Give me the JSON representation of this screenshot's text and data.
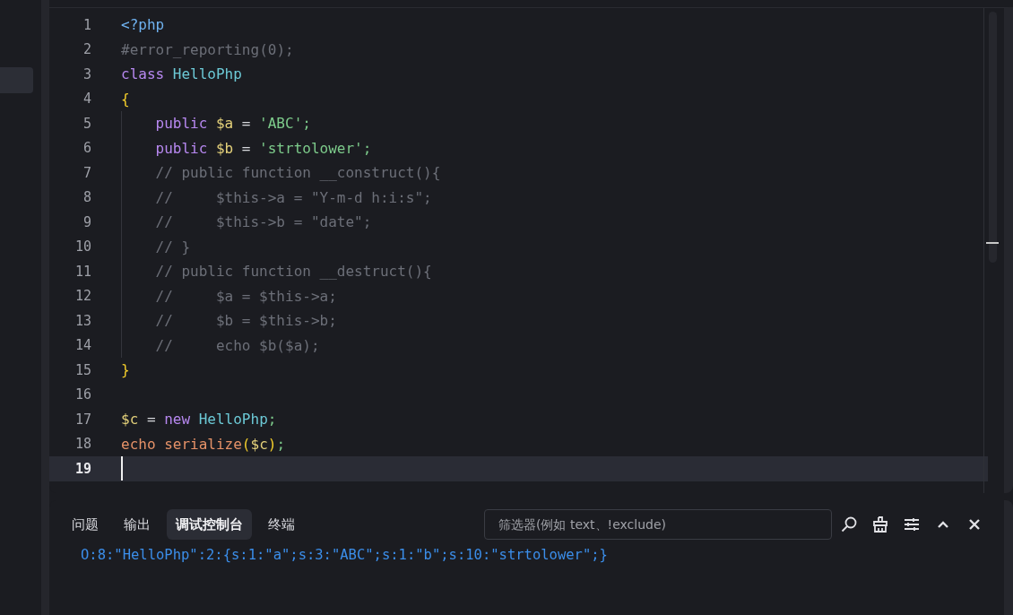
{
  "editor": {
    "lines": [
      {
        "number": "1",
        "indent": false,
        "current": false,
        "tokens": [
          {
            "kind": "tag",
            "text": "<?php"
          }
        ]
      },
      {
        "number": "2",
        "indent": false,
        "current": false,
        "tokens": [
          {
            "kind": "comment",
            "text": "#error_reporting(0);"
          }
        ]
      },
      {
        "number": "3",
        "indent": false,
        "current": false,
        "tokens": [
          {
            "kind": "keyword",
            "text": "class"
          },
          {
            "kind": "class",
            "text": " HelloPhp"
          }
        ]
      },
      {
        "number": "4",
        "indent": false,
        "current": false,
        "tokens": [
          {
            "kind": "brace",
            "text": "{"
          }
        ]
      },
      {
        "number": "5",
        "indent": true,
        "current": false,
        "tokens": [
          {
            "kind": "keyword",
            "text": "public"
          },
          {
            "kind": "var",
            "text": " $a"
          },
          {
            "kind": "plain",
            "text": " ="
          },
          {
            "kind": "string",
            "text": " 'ABC'"
          },
          {
            "kind": "punct",
            "text": ";"
          }
        ]
      },
      {
        "number": "6",
        "indent": true,
        "current": false,
        "tokens": [
          {
            "kind": "keyword",
            "text": "public"
          },
          {
            "kind": "var",
            "text": " $b"
          },
          {
            "kind": "plain",
            "text": " ="
          },
          {
            "kind": "string",
            "text": " 'strtolower'"
          },
          {
            "kind": "punct",
            "text": ";"
          }
        ]
      },
      {
        "number": "7",
        "indent": true,
        "current": false,
        "tokens": [
          {
            "kind": "comment",
            "text": "// public function __construct(){"
          }
        ]
      },
      {
        "number": "8",
        "indent": true,
        "current": false,
        "tokens": [
          {
            "kind": "comment",
            "text": "//     $this->a = \"Y-m-d h:i:s\";"
          }
        ]
      },
      {
        "number": "9",
        "indent": true,
        "current": false,
        "tokens": [
          {
            "kind": "comment",
            "text": "//     $this->b = \"date\";"
          }
        ]
      },
      {
        "number": "10",
        "indent": true,
        "current": false,
        "tokens": [
          {
            "kind": "comment",
            "text": "// }"
          }
        ]
      },
      {
        "number": "11",
        "indent": true,
        "current": false,
        "tokens": [
          {
            "kind": "comment",
            "text": "// public function __destruct(){"
          }
        ]
      },
      {
        "number": "12",
        "indent": true,
        "current": false,
        "tokens": [
          {
            "kind": "comment",
            "text": "//     $a = $this->a;"
          }
        ]
      },
      {
        "number": "13",
        "indent": true,
        "current": false,
        "tokens": [
          {
            "kind": "comment",
            "text": "//     $b = $this->b;"
          }
        ]
      },
      {
        "number": "14",
        "indent": true,
        "current": false,
        "tokens": [
          {
            "kind": "comment",
            "text": "//     echo $b($a);"
          }
        ]
      },
      {
        "number": "15",
        "indent": false,
        "current": false,
        "tokens": [
          {
            "kind": "brace",
            "text": "}"
          }
        ]
      },
      {
        "number": "16",
        "indent": false,
        "current": false
      },
      {
        "number": "17",
        "indent": false,
        "current": false,
        "tokens": [
          {
            "kind": "var",
            "text": "$c"
          },
          {
            "kind": "plain",
            "text": " ="
          },
          {
            "kind": "keyword",
            "text": " new"
          },
          {
            "kind": "class",
            "text": " HelloPhp"
          },
          {
            "kind": "punct",
            "text": ";"
          }
        ]
      },
      {
        "number": "18",
        "indent": false,
        "current": false,
        "tokens": [
          {
            "kind": "func",
            "text": "echo"
          },
          {
            "kind": "func",
            "text": " serialize"
          },
          {
            "kind": "brace",
            "text": "("
          },
          {
            "kind": "var",
            "text": "$c"
          },
          {
            "kind": "brace",
            "text": ")"
          },
          {
            "kind": "punct",
            "text": ";"
          }
        ]
      },
      {
        "number": "19",
        "indent": false,
        "current": true
      }
    ]
  },
  "panel": {
    "tabs": [
      {
        "label": "问题",
        "selected": false
      },
      {
        "label": "输出",
        "selected": false
      },
      {
        "label": "调试控制台",
        "selected": true
      },
      {
        "label": "终端",
        "selected": false
      }
    ],
    "filter": {
      "placeholder": "筛选器(例如 text、!exclude)"
    },
    "output": "O:8:\"HelloPhp\":2:{s:1:\"a\";s:3:\"ABC\";s:1:\"b\";s:10:\"strtolower\";}"
  }
}
